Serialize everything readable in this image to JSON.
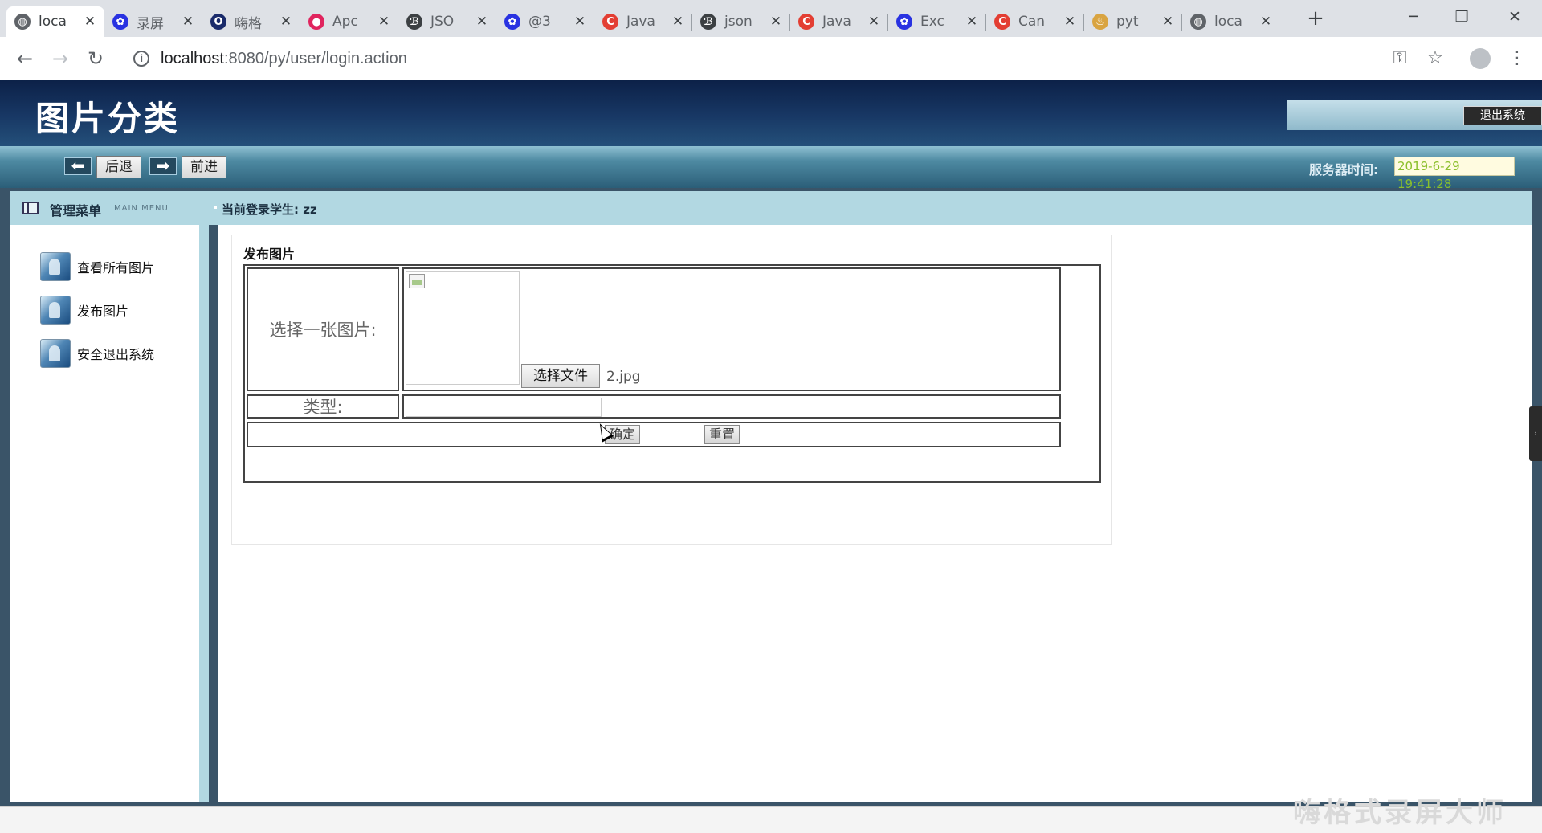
{
  "browser": {
    "tabs": [
      {
        "title": "loca",
        "fav_icon": "globe-icon",
        "fav_color": "#5f6368",
        "active": true
      },
      {
        "title": "录屏",
        "fav_icon": "baidu-paw-icon",
        "fav_color": "#2932e1",
        "active": false
      },
      {
        "title": "嗨格",
        "fav_icon": "opera-icon",
        "fav_color": "#1a2b6b",
        "active": false
      },
      {
        "title": "Apc",
        "fav_icon": "record-icon",
        "fav_color": "#e0245e",
        "active": false
      },
      {
        "title": "JSO",
        "fav_icon": "scroll-icon",
        "fav_color": "#3c4043",
        "active": false
      },
      {
        "title": "@3",
        "fav_icon": "baidu-paw-icon",
        "fav_color": "#2932e1",
        "active": false
      },
      {
        "title": "Java",
        "fav_icon": "csdn-icon",
        "fav_color": "#e33e33",
        "active": false
      },
      {
        "title": "json",
        "fav_icon": "scroll-icon",
        "fav_color": "#3c4043",
        "active": false
      },
      {
        "title": "Java",
        "fav_icon": "csdn-icon",
        "fav_color": "#e33e33",
        "active": false
      },
      {
        "title": "Exc",
        "fav_icon": "baidu-paw-icon",
        "fav_color": "#2932e1",
        "active": false
      },
      {
        "title": "Can",
        "fav_icon": "csdn-icon",
        "fav_color": "#e33e33",
        "active": false
      },
      {
        "title": "pyt",
        "fav_icon": "python-icon",
        "fav_color": "#d9a441",
        "active": false
      },
      {
        "title": "loca",
        "fav_icon": "globe-icon",
        "fav_color": "#5f6368",
        "active": false
      }
    ],
    "close_glyph": "✕",
    "new_tab_glyph": "+",
    "url_host": "localhost",
    "url_path": ":8080/py/user/login.action"
  },
  "app": {
    "title": "图片分类",
    "logout_label": "退出系统",
    "back_label": "后退",
    "forward_label": "前进",
    "server_time_label": "服务器时间:",
    "server_time": "2019-6-29 19:41:28",
    "menu_title": "管理菜单",
    "menu_subtitle": "MAIN MENU",
    "current_user": "当前登录学生: zz",
    "sidebar": [
      {
        "label": "查看所有图片"
      },
      {
        "label": "发布图片"
      },
      {
        "label": "安全退出系统"
      }
    ],
    "form": {
      "panel_title": "发布图片",
      "choose_image_label": "选择一张图片:",
      "choose_file_button": "选择文件",
      "file_name": "2.jpg",
      "type_label": "类型:",
      "type_value": "",
      "confirm_button": "确定",
      "reset_button": "重置"
    }
  },
  "watermark": "嗨格式录屏大师",
  "colors": {
    "header_dark": "#0c2148",
    "nav_bar": "#2b5e78",
    "light_blue": "#b2d8e2",
    "server_time_text": "#8bbf2b"
  }
}
